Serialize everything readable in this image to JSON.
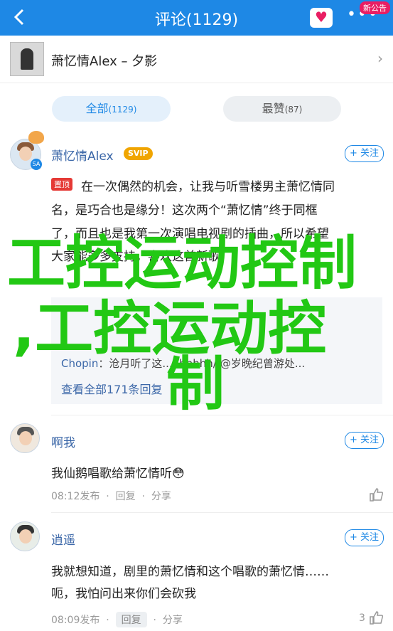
{
  "header": {
    "title": "评论(1129)",
    "badge": "新公告"
  },
  "song": {
    "name": "萧忆情Alex – 夕影"
  },
  "tabs": [
    {
      "label": "全部",
      "count": "(1129)"
    },
    {
      "label": "最赞",
      "count": "(87)"
    }
  ],
  "comments": [
    {
      "user": "萧忆情Alex",
      "vip": "SVIP",
      "follow": "+ 关注",
      "pin": "置顶",
      "lines": [
        "在一次偶然的机会，让我与听雪楼男主萧忆情同",
        "名，是巧合也是缘分！这次两个“萧忆情”终于同框",
        "了，而且也是我第一次演唱电视剧的插曲，所以希望",
        "大家能多多支持，喜欢这首新歌"
      ],
      "replies_visible": [
        {
          "user": "Chopin",
          "text": "沧月听了这...hhhhhh//@岁晚纪曾游处..."
        }
      ],
      "replies_link": "查看全部171条回复"
    },
    {
      "user": "啊我",
      "follow": "+ 关注",
      "lines": [
        "我仙鹅唱歌给萧忆情听😳"
      ],
      "time": "08:12发布",
      "reply": "回复",
      "share": "分享"
    },
    {
      "user": "逍遥",
      "follow": "+ 关注",
      "lines": [
        "我就想知道，剧里的萧忆情和这个唱歌的萧忆情……",
        "呃，我怕问出来你们会砍我"
      ],
      "time": "08:09发布",
      "reply": "回复",
      "share": "分享",
      "likes": "3"
    }
  ],
  "watermark": {
    "line1": "工控运动控制",
    "line2": ",工控运动控",
    "line3": "制"
  }
}
